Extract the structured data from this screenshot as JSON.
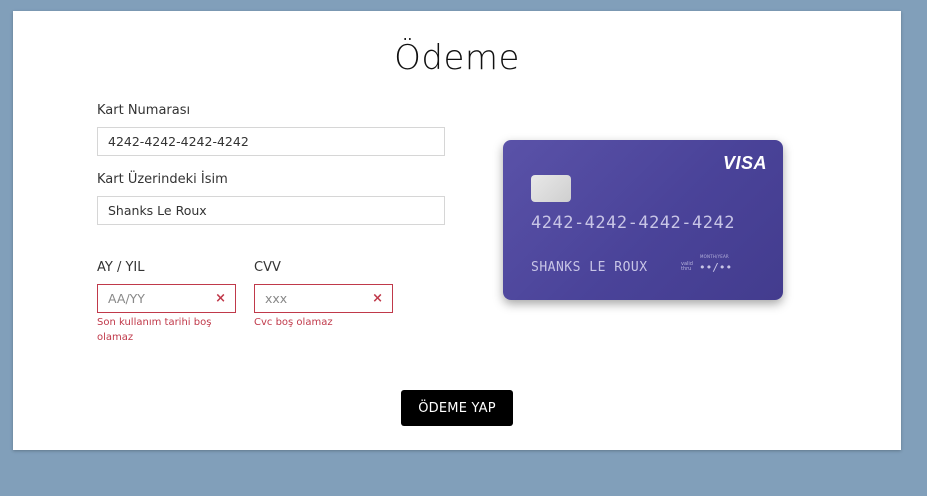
{
  "page": {
    "title": "Ödeme"
  },
  "form": {
    "card_number": {
      "label": "Kart Numarası",
      "value": "4242-4242-4242-4242"
    },
    "card_name": {
      "label": "Kart Üzerindeki İsim",
      "value": "Shanks Le Roux"
    },
    "expiry": {
      "label": "AY / YIL",
      "placeholder": "AA/YY",
      "value": "",
      "error": "Son kullanım tarihi boş olamaz"
    },
    "cvv": {
      "label": "CVV",
      "placeholder": "xxx",
      "value": "",
      "error": "Cvc boş olamaz"
    },
    "submit_label": "ÖDEME YAP"
  },
  "card_preview": {
    "brand": "VISA",
    "number": "4242-4242-4242-4242",
    "holder": "SHANKS LE ROUX",
    "valid_thru": "valid thru",
    "month_year": "MONTH/YEAR",
    "expiry": "••/••"
  },
  "colors": {
    "background": "#819fba",
    "card": "#4a4399",
    "error": "#c0394a",
    "button": "#000000"
  },
  "icons": {
    "clear": "×"
  }
}
